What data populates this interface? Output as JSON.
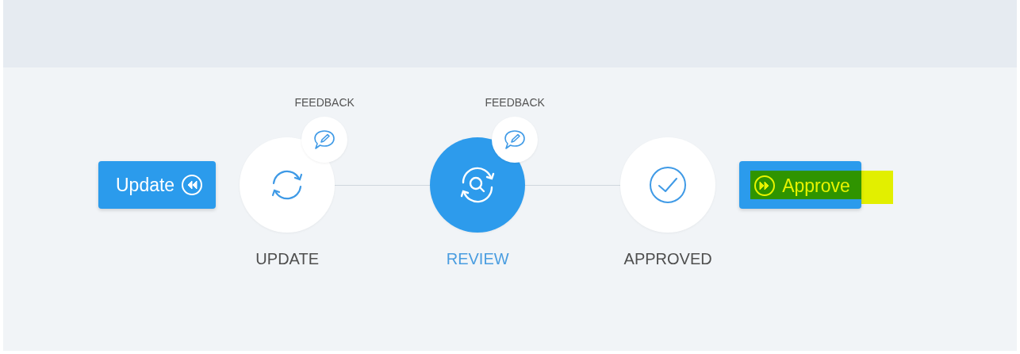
{
  "back_button": {
    "label": "Update"
  },
  "steps": [
    {
      "kind": "update",
      "label": "UPDATE",
      "selected": false,
      "feedback": "FEEDBACK"
    },
    {
      "kind": "review",
      "label": "REVIEW",
      "selected": true,
      "feedback": "FEEDBACK"
    },
    {
      "kind": "approved",
      "label": "APPROVED",
      "selected": false
    }
  ],
  "forward_button": {
    "label": "Approve",
    "highlighted": true
  }
}
